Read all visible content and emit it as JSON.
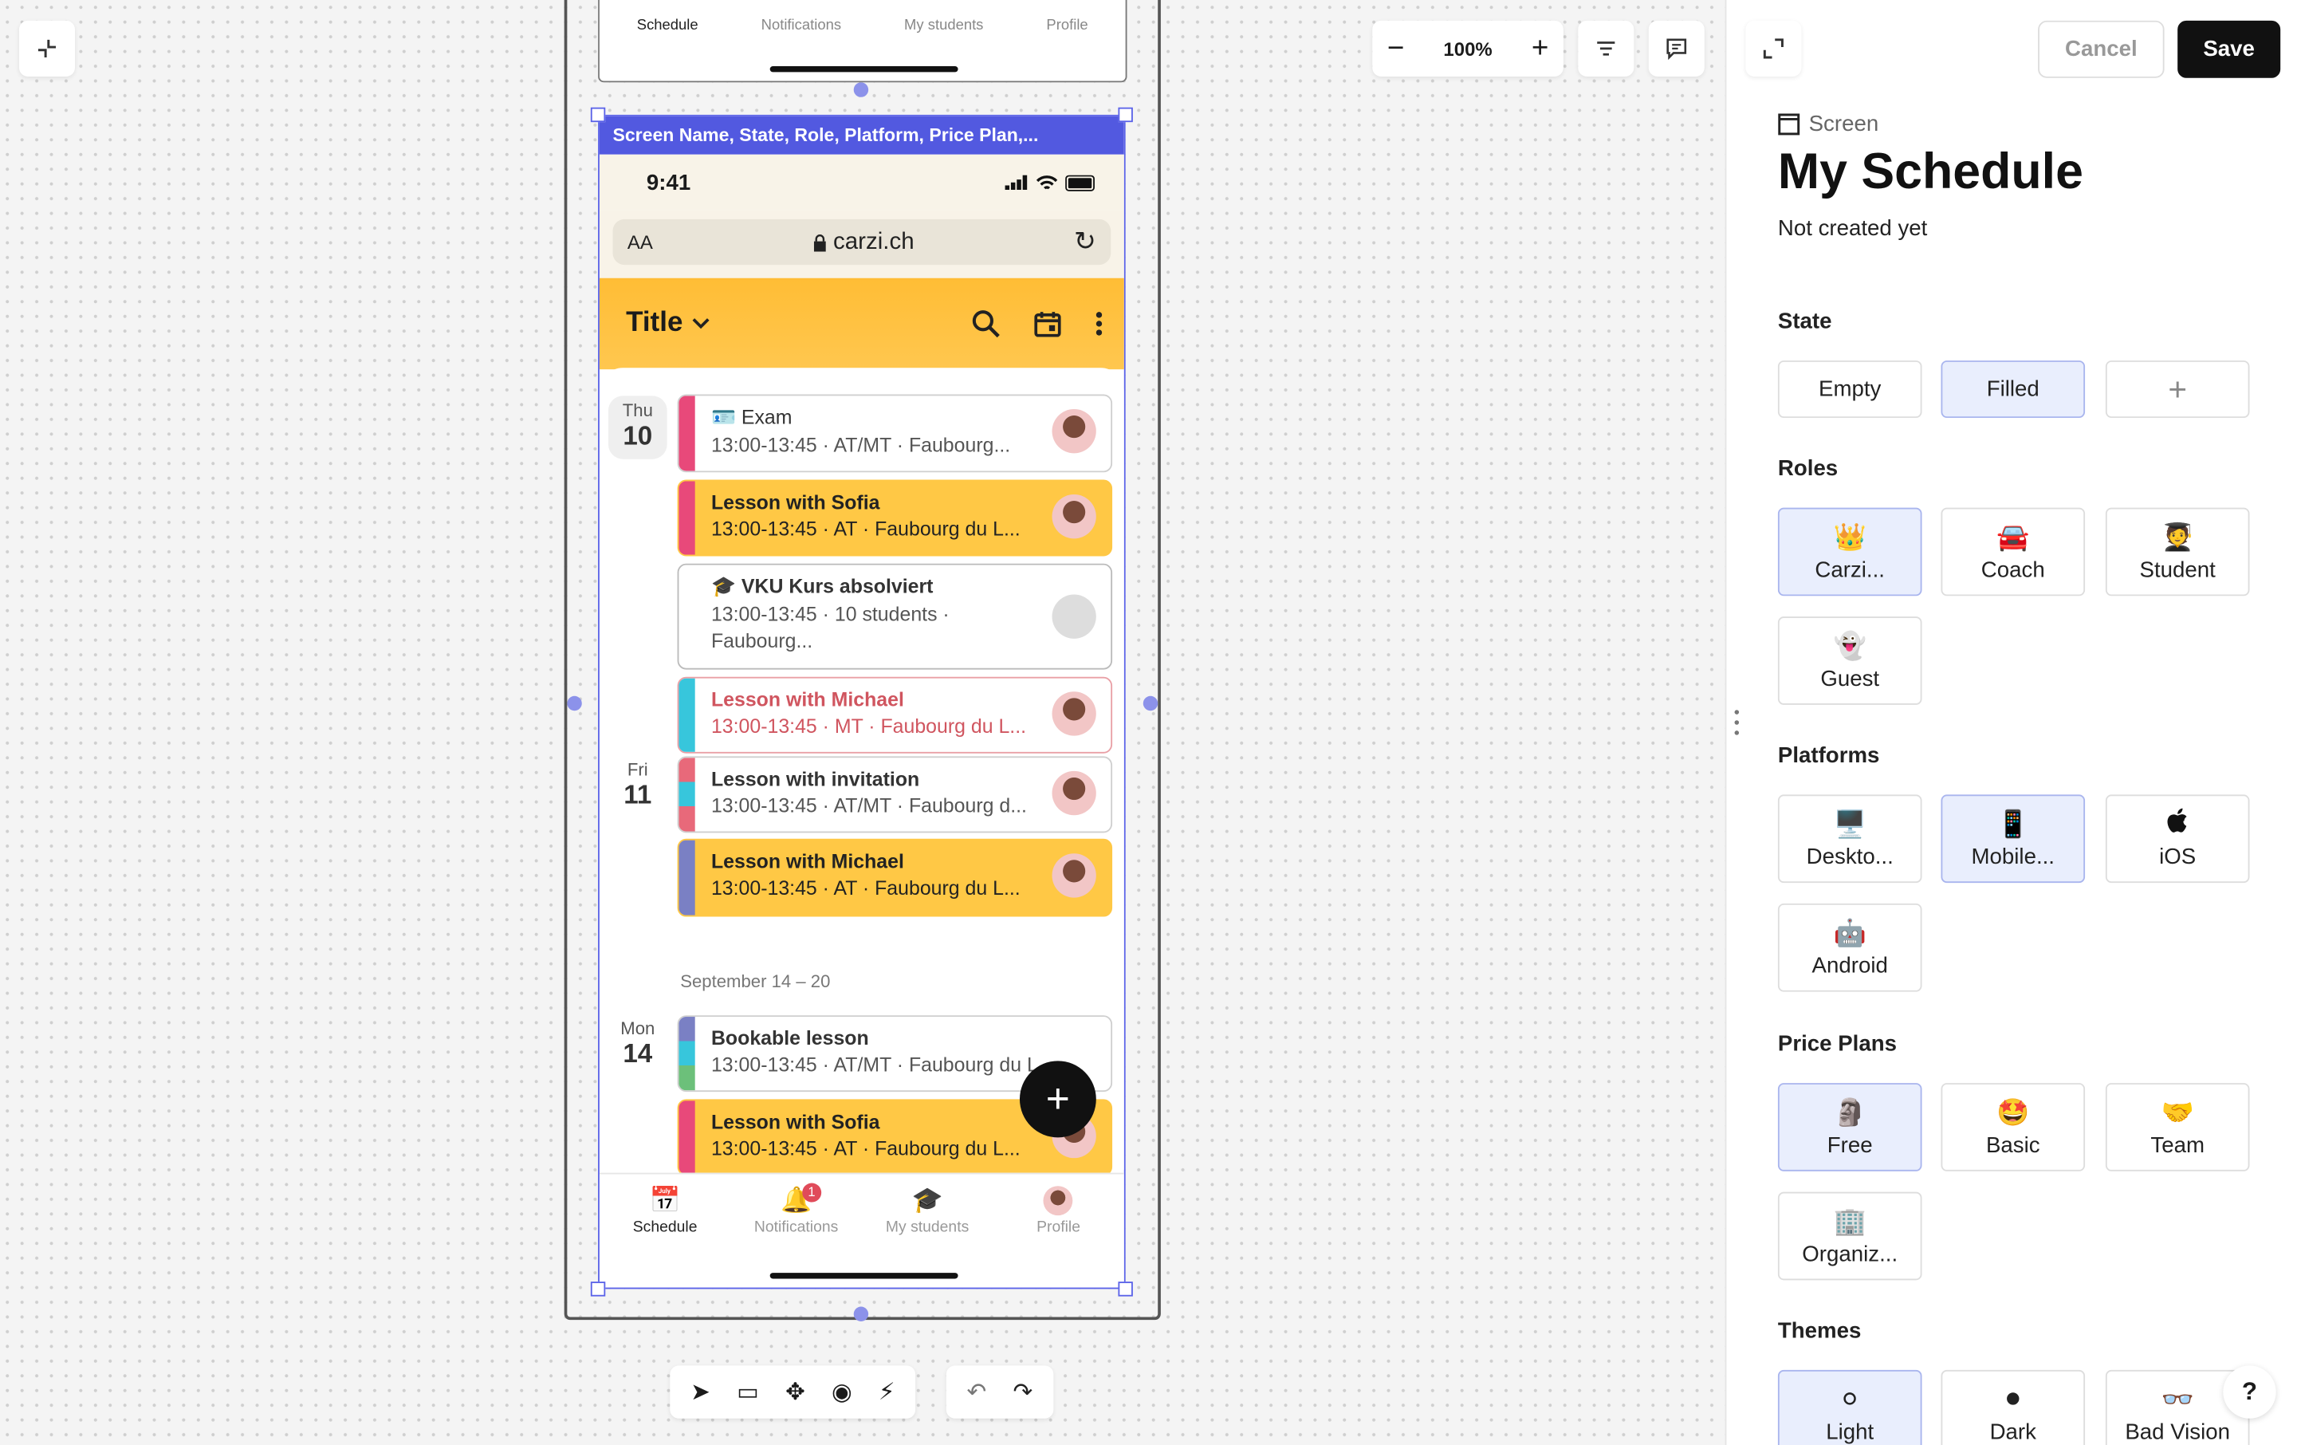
{
  "canvas": {
    "zoom": "100%",
    "previous_screen_tabs": [
      "Schedule",
      "Notifications",
      "My students",
      "Profile"
    ]
  },
  "screen": {
    "label": "Screen Name, State, Role, Platform, Price Plan,...",
    "status_time": "9:41",
    "url_aa": "AA",
    "url": "carzi.ch",
    "app_title": "Title",
    "days": [
      {
        "weekday": "Thu",
        "num": "10"
      },
      {
        "weekday": "Fri",
        "num": "11"
      },
      {
        "weekday": "Mon",
        "num": "14"
      }
    ],
    "week_label": "September 14 – 20",
    "events": [
      {
        "title": "Exam",
        "sub": "13:00-13:45 · AT/MT · Faubourg..."
      },
      {
        "title": "Lesson with Sofia",
        "sub": "13:00-13:45 · AT · Faubourg du L..."
      },
      {
        "title": "VKU Kurs absolviert",
        "sub": "13:00-13:45 · 10 students ·",
        "sub2": "Faubourg..."
      },
      {
        "title": "Lesson with Michael",
        "sub": "13:00-13:45 · MT · Faubourg du L..."
      },
      {
        "title": "Lesson with invitation",
        "sub": "13:00-13:45 · AT/MT · Faubourg d..."
      },
      {
        "title": "Lesson with Michael",
        "sub": "13:00-13:45 · AT · Faubourg du L..."
      },
      {
        "title": "Bookable lesson",
        "sub": "13:00-13:45 · AT/MT · Faubourg du L..."
      },
      {
        "title": "Lesson with Sofia",
        "sub": "13:00-13:45 · AT · Faubourg du L..."
      }
    ],
    "tabs": [
      "Schedule",
      "Notifications",
      "My students",
      "Profile"
    ],
    "notification_badge": "1"
  },
  "panel": {
    "cancel": "Cancel",
    "save": "Save",
    "type_label": "Screen",
    "title": "My Schedule",
    "subtitle": "Not created yet",
    "sections": {
      "state": "State",
      "roles": "Roles",
      "platforms": "Platforms",
      "price_plans": "Price Plans",
      "themes": "Themes"
    },
    "state_options": [
      "Empty",
      "Filled"
    ],
    "roles": [
      {
        "icon": "👑",
        "label": "Carzi..."
      },
      {
        "icon": "🚘",
        "label": "Coach"
      },
      {
        "icon": "🧑‍🎓",
        "label": "Student"
      },
      {
        "icon": "👻",
        "label": "Guest"
      }
    ],
    "platforms": [
      {
        "icon": "🖥️",
        "label": "Deskto..."
      },
      {
        "icon": "📱",
        "label": "Mobile..."
      },
      {
        "icon": "",
        "label": "iOS"
      },
      {
        "icon": "🤖",
        "label": "Android"
      }
    ],
    "price_plans": [
      {
        "icon": "🗿",
        "label": "Free"
      },
      {
        "icon": "🤩",
        "label": "Basic"
      },
      {
        "icon": "🤝",
        "label": "Team"
      },
      {
        "icon": "🏢",
        "label": "Organiz..."
      }
    ],
    "themes": [
      {
        "icon": "⚪",
        "label": "Light"
      },
      {
        "icon": "⚫",
        "label": "Dark"
      },
      {
        "icon": "👓",
        "label": "Bad Vision"
      }
    ],
    "help": "?"
  }
}
